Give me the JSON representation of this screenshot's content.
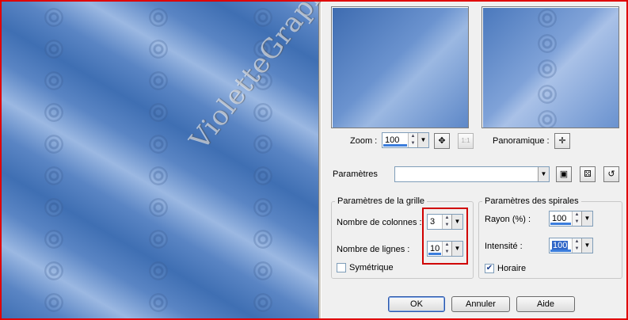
{
  "zoom": {
    "label": "Zoom :",
    "value": "100"
  },
  "pan": {
    "label": "Panoramique :"
  },
  "preset": {
    "label": "Paramètres",
    "value": ""
  },
  "grid_group": {
    "title": "Paramètres de la grille",
    "columns": {
      "label": "Nombre de colonnes :",
      "value": "3"
    },
    "rows": {
      "label": "Nombre de lignes :",
      "value": "10"
    },
    "symmetric": {
      "label": "Symétrique",
      "checked": false
    }
  },
  "spiral_group": {
    "title": "Paramètres des spirales",
    "radius": {
      "label": "Rayon (%) :",
      "value": "100"
    },
    "intensity": {
      "label": "Intensité :",
      "value": "100"
    },
    "clockwise": {
      "label": "Horaire",
      "checked": true
    }
  },
  "buttons": {
    "ok": "OK",
    "cancel": "Annuler",
    "help": "Aide"
  },
  "watermark": "VioletteGraphic",
  "icons": {
    "zoom_fit": "fit-view-icon",
    "zoom_actual": "actual-size-icon",
    "pan": "move-arrows-icon",
    "save": "save-disk-icon",
    "random": "dice-icon",
    "reset": "reset-icon"
  }
}
